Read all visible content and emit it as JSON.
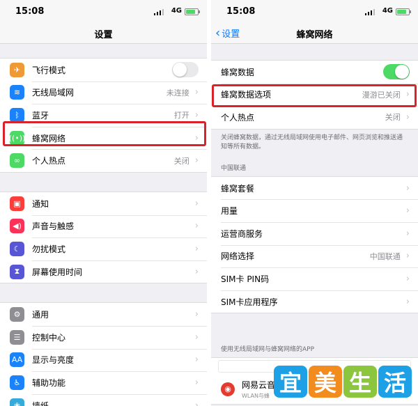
{
  "left": {
    "status": {
      "time": "15:08",
      "network": "4G"
    },
    "nav_title": "设置",
    "group1": [
      {
        "label": "飞行模式",
        "icon": "airplane-icon",
        "color": "#f09a37",
        "glyph": "✈",
        "toggle": "off"
      },
      {
        "label": "无线局域网",
        "icon": "wifi-icon",
        "color": "#1a82fb",
        "glyph": "≋",
        "value": "未连接"
      },
      {
        "label": "蓝牙",
        "icon": "bluetooth-icon",
        "color": "#1a82fb",
        "glyph": "ᛒ",
        "value": "打开"
      },
      {
        "label": "蜂窝网络",
        "icon": "antenna-icon",
        "color": "#4cd964",
        "glyph": "((•))",
        "value": ""
      },
      {
        "label": "个人热点",
        "icon": "hotspot-icon",
        "color": "#4cd964",
        "glyph": "∞",
        "value": "关闭"
      }
    ],
    "group2": [
      {
        "label": "通知",
        "icon": "notification-icon",
        "color": "#fc3d39",
        "glyph": "▣"
      },
      {
        "label": "声音与触感",
        "icon": "speaker-icon",
        "color": "#fc3158",
        "glyph": "◀)"
      },
      {
        "label": "勿扰模式",
        "icon": "moon-icon",
        "color": "#5856d6",
        "glyph": "☾"
      },
      {
        "label": "屏幕使用时间",
        "icon": "hourglass-icon",
        "color": "#5856d6",
        "glyph": "⧗"
      }
    ],
    "group3": [
      {
        "label": "通用",
        "icon": "gear-icon",
        "color": "#8e8e93",
        "glyph": "⚙"
      },
      {
        "label": "控制中心",
        "icon": "switches-icon",
        "color": "#8e8e93",
        "glyph": "☰"
      },
      {
        "label": "显示与亮度",
        "icon": "text-size-icon",
        "color": "#1a82fb",
        "glyph": "AA"
      },
      {
        "label": "辅助功能",
        "icon": "accessibility-icon",
        "color": "#1a82fb",
        "glyph": "♿"
      },
      {
        "label": "墙纸",
        "icon": "flower-icon",
        "color": "#35aadc",
        "glyph": "❀"
      }
    ]
  },
  "right": {
    "status": {
      "time": "15:08",
      "network": "4G"
    },
    "back_label": "设置",
    "nav_title": "蜂窝网络",
    "group1": [
      {
        "label": "蜂窝数据",
        "toggle": "on"
      },
      {
        "label": "蜂窝数据选项",
        "value": "漫游已关闭"
      },
      {
        "label": "个人热点",
        "value": "关闭"
      }
    ],
    "note": "关闭蜂窝数据，通过无线局域网使用电子邮件、网页浏览和推送通知等所有数据。",
    "carrier_header": "中国联通",
    "group2": [
      {
        "label": "蜂窝套餐",
        "value": ""
      },
      {
        "label": "用量",
        "value": ""
      },
      {
        "label": "运营商服务",
        "value": ""
      },
      {
        "label": "网络选择",
        "value": "中国联通"
      },
      {
        "label": "SIM卡 PIN码",
        "value": ""
      },
      {
        "label": "SIM卡应用程序",
        "value": ""
      }
    ],
    "apps_header": "使用无线局域网与蜂窝网络的APP",
    "app": {
      "name": "网易云音",
      "sub": "WLAN与蜂",
      "icon": "music-app-icon",
      "glyph": "◉"
    }
  },
  "watermark": {
    "chars": [
      "宜",
      "美",
      "生",
      "活"
    ],
    "colors": [
      "#1ea0e6",
      "#f28c1e",
      "#8cc63e",
      "#1ea0e6"
    ]
  },
  "highlight_color": "#d8232a"
}
